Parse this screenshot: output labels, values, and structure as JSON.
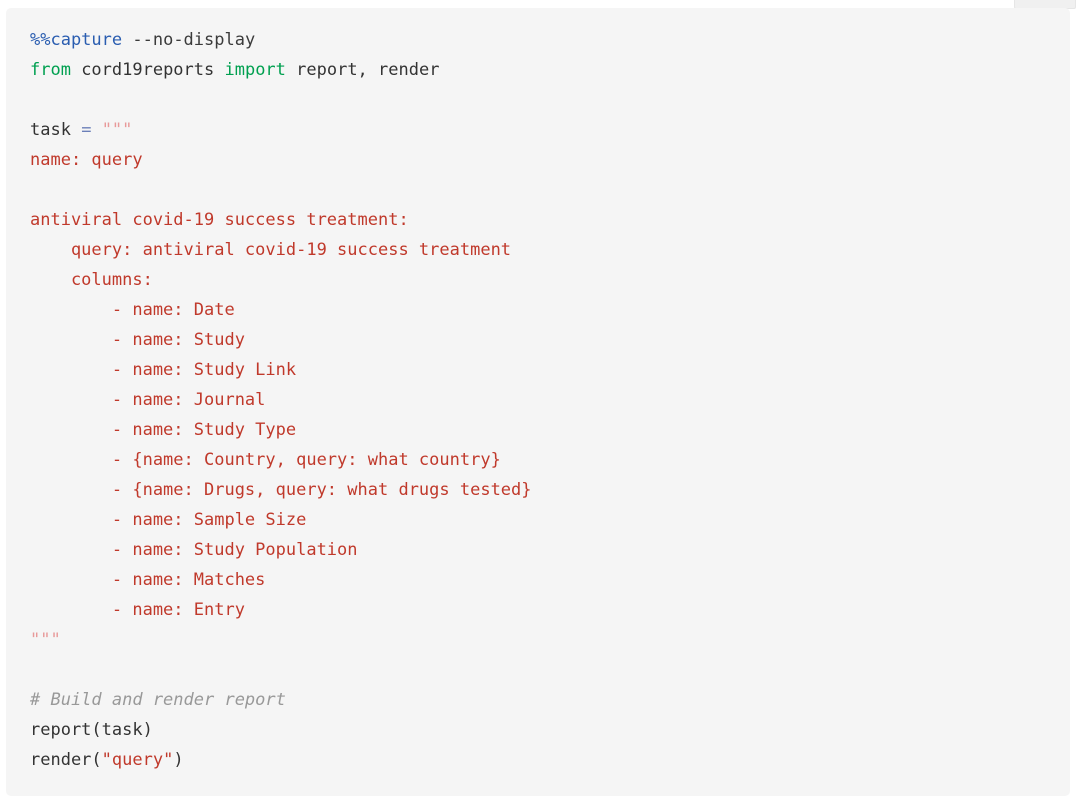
{
  "cell": {
    "kind": "code-cell",
    "background_color": "#f5f5f5",
    "page_background_color": "#ffffff",
    "language": "python"
  },
  "colors": {
    "magic": "#2a5db0",
    "keyword": "#00a050",
    "operator": "#6b7fb8",
    "string": "#c0392b",
    "quote": "#e89a9a",
    "comment": "#999999",
    "plain": "#333333"
  },
  "code": {
    "lines": [
      {
        "id": "line-1",
        "tokens": [
          {
            "t": "%%capture",
            "c": "tok-magic"
          },
          {
            "t": " ",
            "c": "tok-punct"
          },
          {
            "t": "--no-display",
            "c": "tok-magic-arg"
          }
        ]
      },
      {
        "id": "line-2",
        "tokens": [
          {
            "t": "from",
            "c": "tok-keyword"
          },
          {
            "t": " cord19reports ",
            "c": "tok-name"
          },
          {
            "t": "import",
            "c": "tok-keyword"
          },
          {
            "t": " report, render",
            "c": "tok-name"
          }
        ]
      },
      {
        "id": "line-3",
        "tokens": []
      },
      {
        "id": "line-4",
        "tokens": [
          {
            "t": "task ",
            "c": "tok-name"
          },
          {
            "t": "=",
            "c": "tok-operator"
          },
          {
            "t": " ",
            "c": "tok-punct"
          },
          {
            "t": "\"\"\"",
            "c": "tok-quote"
          }
        ]
      },
      {
        "id": "line-5",
        "tokens": [
          {
            "t": "name: query",
            "c": "tok-string"
          }
        ]
      },
      {
        "id": "line-6",
        "tokens": []
      },
      {
        "id": "line-7",
        "tokens": [
          {
            "t": "antiviral covid-19 success treatment:",
            "c": "tok-string"
          }
        ]
      },
      {
        "id": "line-8",
        "tokens": [
          {
            "t": "    query: antiviral covid-19 success treatment",
            "c": "tok-string"
          }
        ]
      },
      {
        "id": "line-9",
        "tokens": [
          {
            "t": "    columns:",
            "c": "tok-string"
          }
        ]
      },
      {
        "id": "line-10",
        "tokens": [
          {
            "t": "        - name: Date",
            "c": "tok-string"
          }
        ]
      },
      {
        "id": "line-11",
        "tokens": [
          {
            "t": "        - name: Study",
            "c": "tok-string"
          }
        ]
      },
      {
        "id": "line-12",
        "tokens": [
          {
            "t": "        - name: Study Link",
            "c": "tok-string"
          }
        ]
      },
      {
        "id": "line-13",
        "tokens": [
          {
            "t": "        - name: Journal",
            "c": "tok-string"
          }
        ]
      },
      {
        "id": "line-14",
        "tokens": [
          {
            "t": "        - name: Study Type",
            "c": "tok-string"
          }
        ]
      },
      {
        "id": "line-15",
        "tokens": [
          {
            "t": "        - {name: Country, query: what country}",
            "c": "tok-string"
          }
        ]
      },
      {
        "id": "line-16",
        "tokens": [
          {
            "t": "        - {name: Drugs, query: what drugs tested}",
            "c": "tok-string"
          }
        ]
      },
      {
        "id": "line-17",
        "tokens": [
          {
            "t": "        - name: Sample Size",
            "c": "tok-string"
          }
        ]
      },
      {
        "id": "line-18",
        "tokens": [
          {
            "t": "        - name: Study Population",
            "c": "tok-string"
          }
        ]
      },
      {
        "id": "line-19",
        "tokens": [
          {
            "t": "        - name: Matches",
            "c": "tok-string"
          }
        ]
      },
      {
        "id": "line-20",
        "tokens": [
          {
            "t": "        - name: Entry",
            "c": "tok-string"
          }
        ]
      },
      {
        "id": "line-21",
        "tokens": [
          {
            "t": "\"\"\"",
            "c": "tok-quote"
          }
        ]
      },
      {
        "id": "line-22",
        "tokens": []
      },
      {
        "id": "line-23",
        "tokens": [
          {
            "t": "# Build and render report",
            "c": "tok-comment"
          }
        ]
      },
      {
        "id": "line-24",
        "tokens": [
          {
            "t": "report",
            "c": "tok-name"
          },
          {
            "t": "(",
            "c": "tok-punct"
          },
          {
            "t": "task",
            "c": "tok-name"
          },
          {
            "t": ")",
            "c": "tok-punct"
          }
        ]
      },
      {
        "id": "line-25",
        "tokens": [
          {
            "t": "render",
            "c": "tok-name"
          },
          {
            "t": "(",
            "c": "tok-punct"
          },
          {
            "t": "\"query\"",
            "c": "tok-string"
          },
          {
            "t": ")",
            "c": "tok-punct"
          }
        ]
      }
    ]
  }
}
